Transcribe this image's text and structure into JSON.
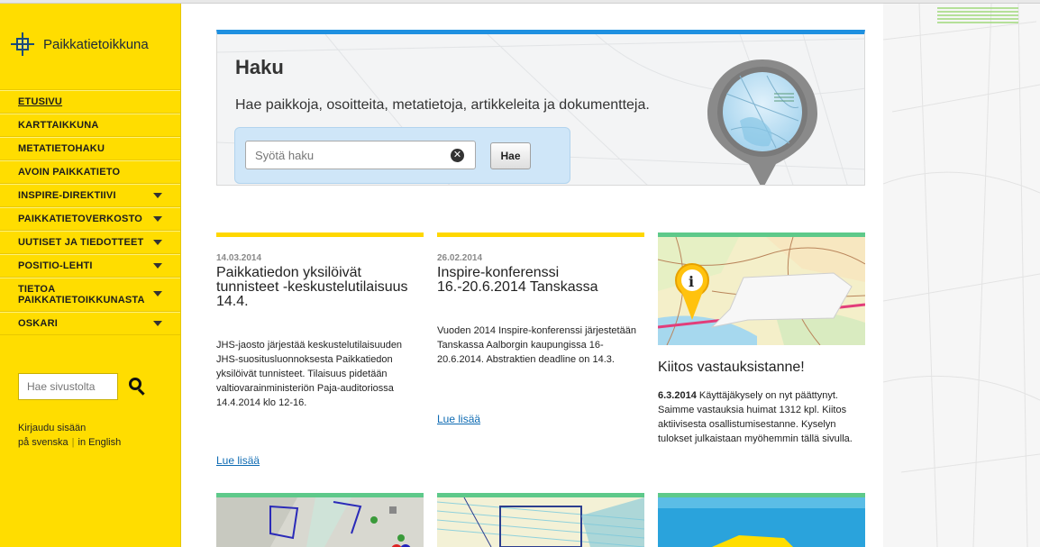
{
  "site": {
    "name": "Paikkatietoikkuna"
  },
  "nav": [
    {
      "label": "ETUSIVU",
      "active": true,
      "submenu": false
    },
    {
      "label": "KARTTAIKKUNA",
      "submenu": false
    },
    {
      "label": "METATIETOHAKU",
      "submenu": false
    },
    {
      "label": "AVOIN PAIKKATIETO",
      "submenu": false
    },
    {
      "label": "INSPIRE-DIREKTIIVI",
      "submenu": true
    },
    {
      "label": "PAIKKATIETOVERKOSTO",
      "submenu": true
    },
    {
      "label": "UUTISET JA TIEDOTTEET",
      "submenu": true
    },
    {
      "label": "POSITIO-LEHTI",
      "submenu": true
    },
    {
      "label": "TIETOA PAIKKATIETOIKKUNASTA",
      "submenu": true
    },
    {
      "label": "OSKARI",
      "submenu": true
    }
  ],
  "site_search": {
    "placeholder": "Hae sivustolta"
  },
  "login": {
    "label": "Kirjaudu sisään",
    "lang_sv": "på svenska",
    "lang_en": "in English"
  },
  "haku": {
    "title": "Haku",
    "lead": "Hae paikkoja, osoitteita, metatietoja, artikkeleita ja dokumentteja.",
    "placeholder": "Syötä haku",
    "button": "Hae"
  },
  "news": [
    {
      "date": "14.03.2014",
      "title": "Paikkatiedon yksilöivät tunnisteet -keskustelutilaisuus 14.4.",
      "body": "JHS-jaosto järjestää keskustelutilaisuuden JHS-suosituslu­onnoksesta Paikkatiedon yksilöivät tunnisteet. Tilaisuus pidetään valtiovarainministeriön Paja-auditoriossa 14.4.2014 klo 12-16.",
      "more": "Lue lisää"
    },
    {
      "date": "26.02.2014",
      "title": "Inspire-konferenssi 16.-20.6.2014 Tanskassa",
      "body": "Vuoden 2014 Inspire-konferenssi järjestetään Tanskassa Aalborgin kaupungissa 16-20.6.2014. Abstraktien deadline on 14.3.",
      "more": "Lue lisää"
    }
  ],
  "feature": {
    "title": "Kiitos vastauksistanne!",
    "date": "6.3.2014",
    "body": " Käyttäjäkysely on nyt päättynyt. Saimme vastauksia huimat 1312 kpl. Kiitos aktiivisesta osallistumisestanne. Kyselyn tulokset julkaistaan myöhemmin tällä sivulla."
  },
  "colors": {
    "sidebar": "#ffdd00",
    "accent_blue": "#1e90e0",
    "news_bar": "#ffd700",
    "feature_bar": "#5ec98a",
    "link": "#0e6bb3"
  }
}
